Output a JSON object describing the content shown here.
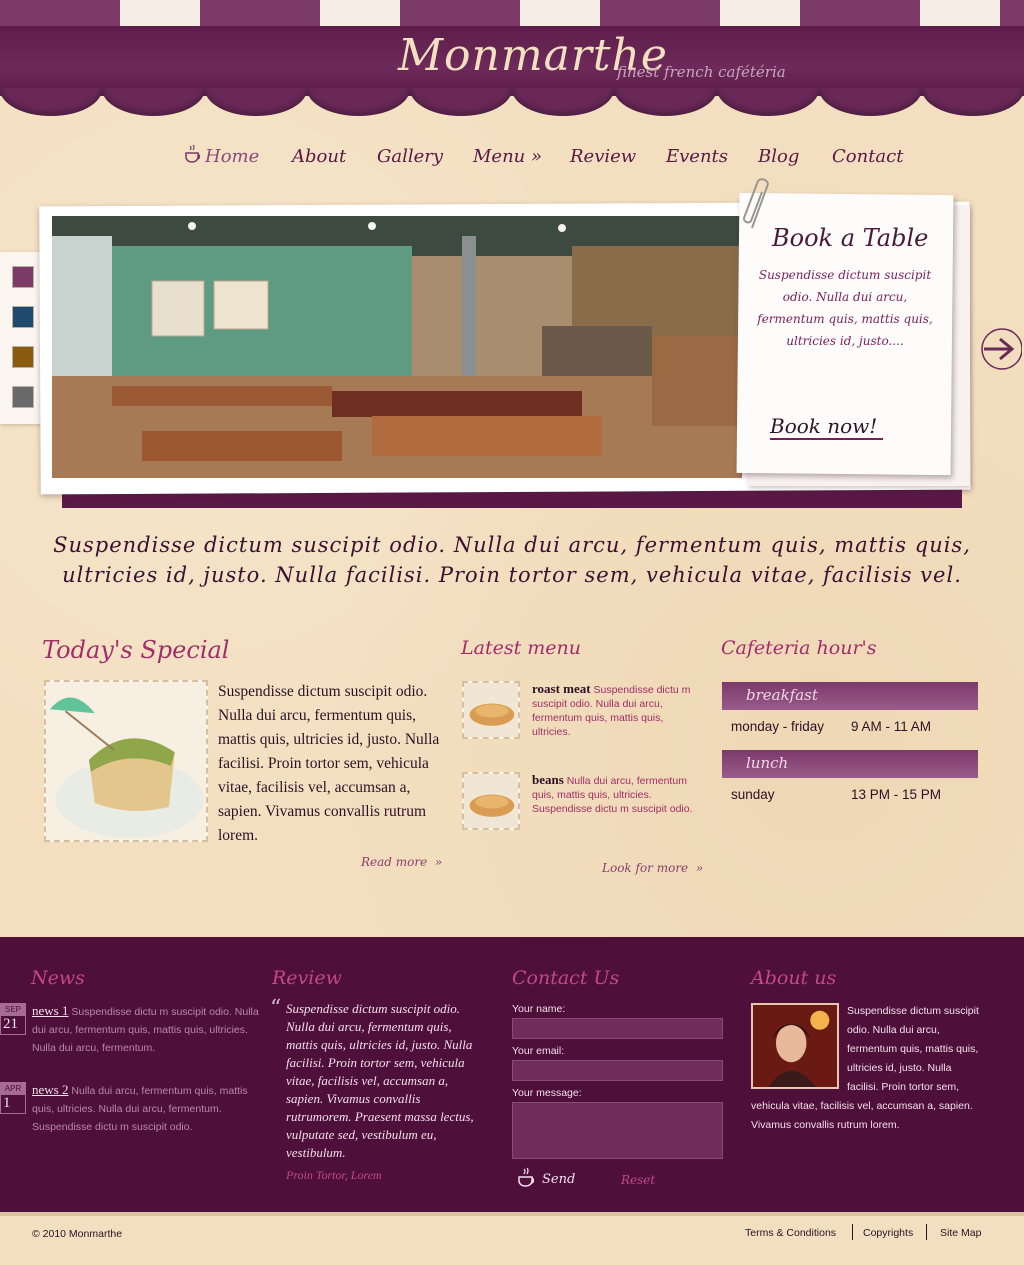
{
  "header": {
    "logo": "Monmarthe",
    "tagline": "finest french cafétéria"
  },
  "nav": {
    "items": [
      {
        "label": "Home"
      },
      {
        "label": "About"
      },
      {
        "label": "Gallery"
      },
      {
        "label": "Menu »"
      },
      {
        "label": "Review"
      },
      {
        "label": "Events"
      },
      {
        "label": "Blog"
      },
      {
        "label": "Contact"
      }
    ]
  },
  "colors": {
    "swatches": [
      "#7b3a68",
      "#1e4a6e",
      "#8a5a10",
      "#6a6a6a"
    ],
    "accent": "#a12e6a",
    "footer_bg": "#4e0f3b"
  },
  "booking": {
    "title": "Book a Table",
    "text": "Suspendisse dictum suscipit odio. Nulla dui arcu, fermentum quis, mattis quis, ultricies id, justo....",
    "button": "Book now!"
  },
  "intro": {
    "text": "Suspendisse dictum suscipit odio. Nulla dui arcu, fermentum quis, mattis quis, ultricies id, justo. Nulla facilisi. Proin tortor sem, vehicula vitae, facilisis vel."
  },
  "special": {
    "heading": "Today's Special",
    "text": "Suspendisse dictum suscipit odio. Nulla dui arcu, fermentum quis, mattis quis, ultricies id, justo. Nulla facilisi. Proin tortor sem, vehicula vitae, facilisis vel, accumsan a, sapien. Vivamus convallis rutrum lorem.",
    "read_more": "Read more"
  },
  "latest_menu": {
    "heading": "Latest menu",
    "items": [
      {
        "name": "roast meat",
        "text": "Suspendisse dictu m suscipit odio. Nulla dui arcu, fermentum quis, mattis quis, ultricies."
      },
      {
        "name": "beans",
        "text": "Nulla dui arcu, fermentum quis, mattis quis, ultricies. Suspendisse dictu m suscipit odio."
      }
    ],
    "look_more": "Look for more"
  },
  "hours": {
    "heading": "Cafeteria hour's",
    "blocks": [
      {
        "label": "breakfast",
        "day": "monday - friday",
        "time": "9 AM - 11 AM"
      },
      {
        "label": "lunch",
        "day": "sunday",
        "time": "13 PM - 15 PM"
      }
    ]
  },
  "footer": {
    "news": {
      "heading": "News",
      "items": [
        {
          "month": "SEP",
          "day": "21",
          "title": "news 1",
          "text": "Suspendisse dictu m suscipit odio. Nulla dui arcu, fermentum quis, mattis quis, ultricies. Nulla dui arcu, fermentum."
        },
        {
          "month": "APR",
          "day": "1",
          "title": "news 2",
          "text": "Nulla dui arcu, fermentum quis, mattis quis, ultricies. Nulla dui arcu, fermentum. Suspendisse dictu m suscipit odio."
        }
      ]
    },
    "review": {
      "heading": "Review",
      "text": "Suspendisse dictum suscipit odio. Nulla dui arcu, fermentum quis, mattis quis, ultricies id, justo. Nulla facilisi. Proin tortor sem, vehicula vitae, facilisis vel, accumsan a, sapien. Vivamus convallis rutrumorem. Praesent massa lectus, vulputate sed, vestibulum eu, vestibulum.",
      "author": "Proin Tortor, Lorem"
    },
    "contact": {
      "heading": "Contact Us",
      "name_label": "Your name:",
      "email_label": "Your email:",
      "message_label": "Your message:",
      "send": "Send",
      "reset": "Reset"
    },
    "about": {
      "heading": "About us",
      "text": "Suspendisse dictum suscipit odio. Nulla dui arcu, fermentum quis, mattis quis, ultricies id, justo. Nulla facilisi. Proin tortor sem, vehicula vitae, facilisis vel, accumsan a, sapien. Vivamus convallis rutrum lorem."
    }
  },
  "bottom": {
    "copyright": "© 2010 Monmarthe",
    "links": [
      "Terms & Conditions",
      "Copyrights",
      "Site Map"
    ]
  }
}
